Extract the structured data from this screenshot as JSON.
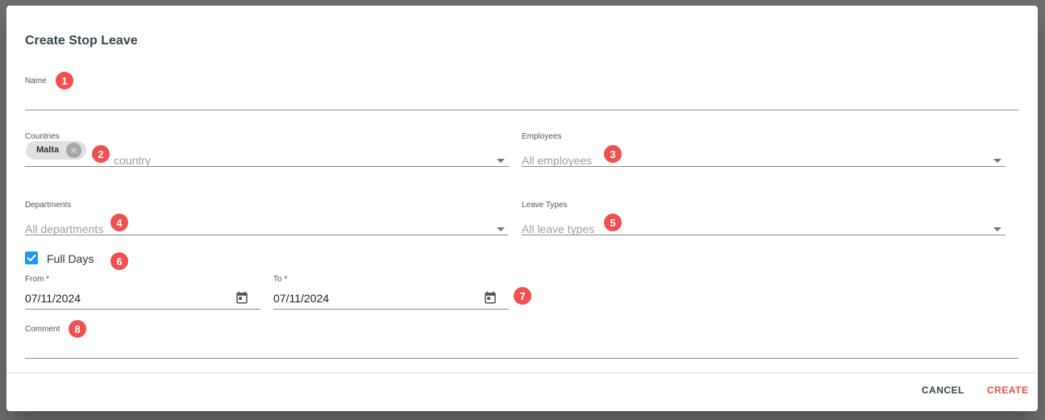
{
  "dialog": {
    "title": "Create Stop Leave",
    "name": {
      "label": "Name",
      "value": ""
    },
    "countries": {
      "label": "Countries",
      "chips": [
        {
          "label": "Malta"
        }
      ],
      "placeholder": "country"
    },
    "employees": {
      "label": "Employees",
      "placeholder": "All employees"
    },
    "departments": {
      "label": "Departments",
      "placeholder": "All departments"
    },
    "leave_types": {
      "label": "Leave Types",
      "placeholder": "All leave types"
    },
    "full_days": {
      "label": "Full Days",
      "checked": true
    },
    "from": {
      "label": "From *",
      "value": "07/11/2024"
    },
    "to": {
      "label": "To *",
      "value": "07/11/2024"
    },
    "comment": {
      "label": "Comment",
      "value": ""
    },
    "cancel_label": "CANCEL",
    "create_label": "CREATE"
  },
  "annotations": [
    "1",
    "2",
    "3",
    "4",
    "5",
    "6",
    "7",
    "8"
  ],
  "colors": {
    "accent": "#f0504f",
    "checkbox": "#2196f3",
    "overlay": "#6e6e6e"
  },
  "icons": {
    "chip_remove": "cancel-circle-icon",
    "dropdown": "chevron-down-icon",
    "date": "calendar-icon",
    "checkbox": "check-icon"
  }
}
